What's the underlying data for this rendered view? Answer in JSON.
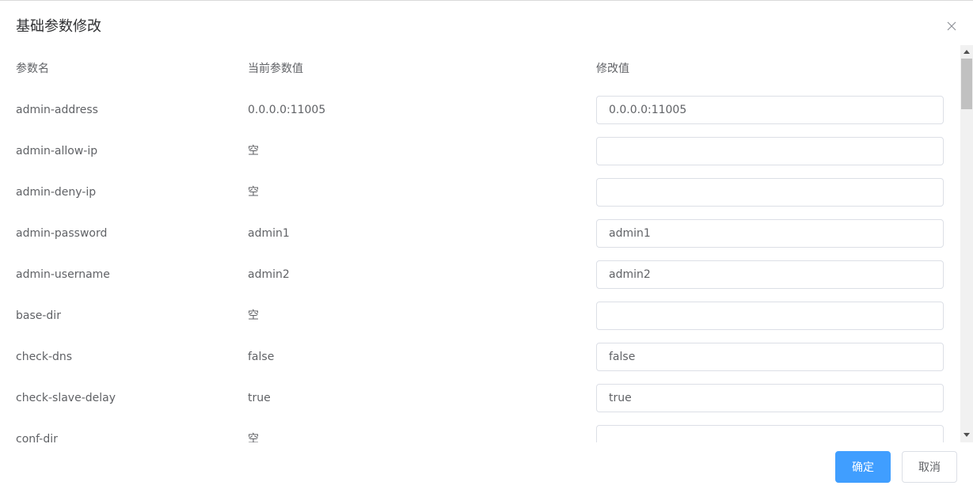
{
  "dialog": {
    "title": "基础参数修改"
  },
  "table": {
    "headers": {
      "name": "参数名",
      "current": "当前参数值",
      "edit": "修改值"
    },
    "rows": [
      {
        "name": "admin-address",
        "current": "0.0.0.0:11005",
        "value": "0.0.0.0:11005"
      },
      {
        "name": "admin-allow-ip",
        "current": "空",
        "value": ""
      },
      {
        "name": "admin-deny-ip",
        "current": "空",
        "value": ""
      },
      {
        "name": "admin-password",
        "current": "admin1",
        "value": "admin1"
      },
      {
        "name": "admin-username",
        "current": "admin2",
        "value": "admin2"
      },
      {
        "name": "base-dir",
        "current": "空",
        "value": ""
      },
      {
        "name": "check-dns",
        "current": "false",
        "value": "false"
      },
      {
        "name": "check-slave-delay",
        "current": "true",
        "value": "true"
      },
      {
        "name": "conf-dir",
        "current": "空",
        "value": ""
      }
    ]
  },
  "footer": {
    "confirm_label": "确定",
    "cancel_label": "取消"
  },
  "colors": {
    "primary": "#409eff",
    "text": "#606266",
    "border": "#dcdfe6"
  }
}
